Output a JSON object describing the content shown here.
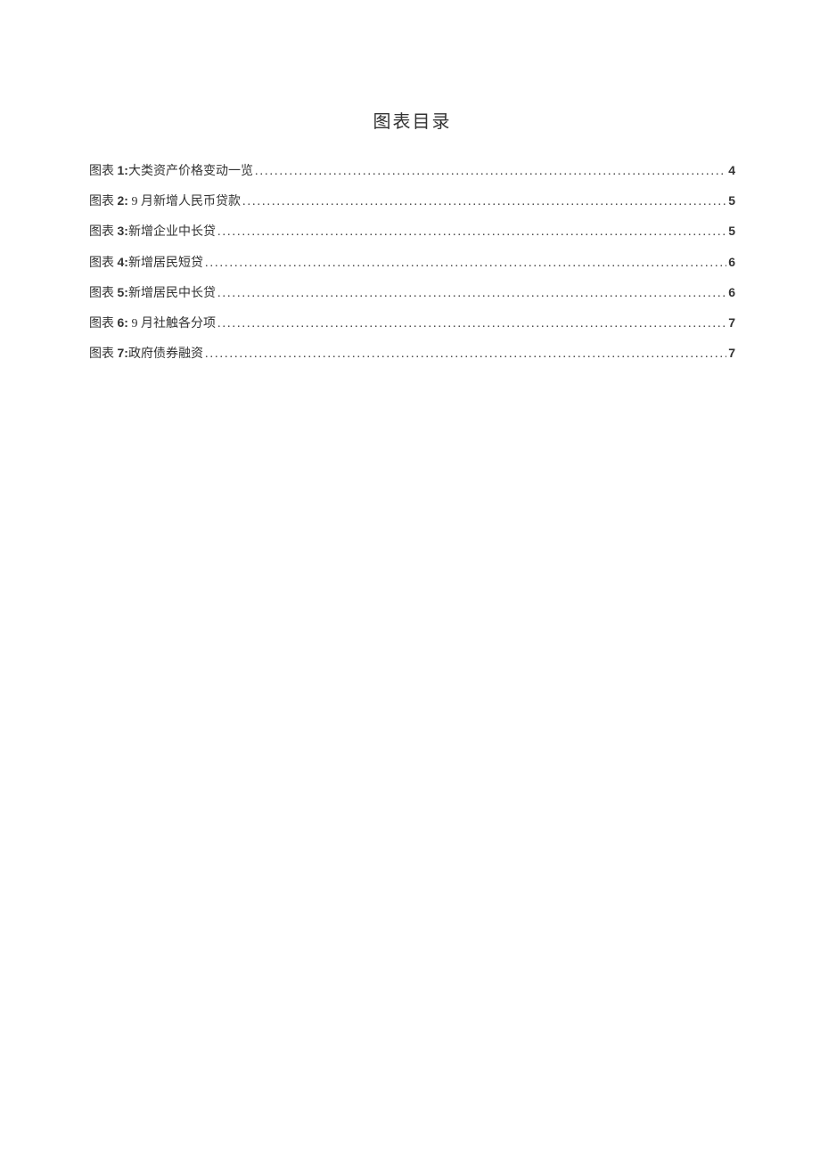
{
  "title": "图表目录",
  "toc": [
    {
      "prefix": "图表",
      "num": "1:",
      "text": "大类资产价格变动一览",
      "page": "4"
    },
    {
      "prefix": "图表",
      "num": "2:",
      "text": "   9 月新增人民币贷款",
      "page": "5"
    },
    {
      "prefix": "图表",
      "num": "3:",
      "text": "新增企业中长贷",
      "page": "5"
    },
    {
      "prefix": "图表",
      "num": "4:",
      "text": "新增居民短贷",
      "page": "6"
    },
    {
      "prefix": "图表",
      "num": "5:",
      "text": "新增居民中长贷",
      "page": "6"
    },
    {
      "prefix": "图表",
      "num": "6:",
      "text": "   9 月社触各分项",
      "page": "7"
    },
    {
      "prefix": "图表",
      "num": "7:",
      "text": "政府债券融资",
      "page": "7"
    }
  ]
}
